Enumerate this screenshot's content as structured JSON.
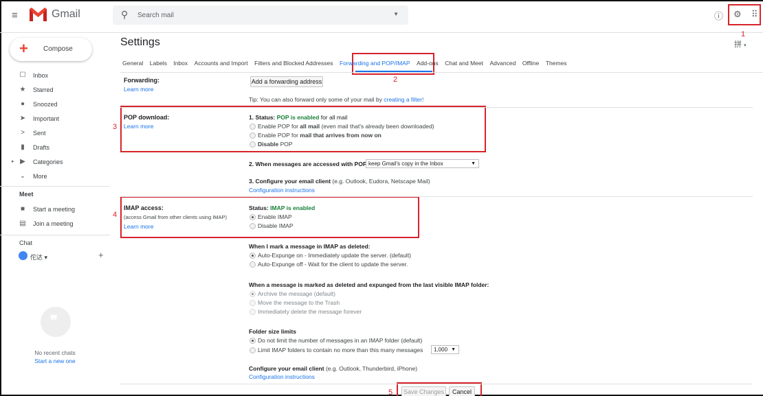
{
  "header": {
    "app_name": "Gmail",
    "search_placeholder": "Search mail"
  },
  "sidebar": {
    "compose_label": "Compose",
    "items": [
      {
        "label": "Inbox",
        "icon": "inbox-icon"
      },
      {
        "label": "Starred",
        "icon": "star-icon"
      },
      {
        "label": "Snoozed",
        "icon": "clock-icon"
      },
      {
        "label": "Important",
        "icon": "important-icon"
      },
      {
        "label": "Sent",
        "icon": "send-icon"
      },
      {
        "label": "Drafts",
        "icon": "draft-icon"
      },
      {
        "label": "Categories",
        "icon": "label-icon"
      },
      {
        "label": "More",
        "icon": "chevron-down-icon"
      }
    ],
    "meet_heading": "Meet",
    "meet_items": [
      {
        "label": "Start a meeting",
        "icon": "video-icon"
      },
      {
        "label": "Join a meeting",
        "icon": "keyboard-icon"
      }
    ],
    "chat_heading": "Chat",
    "chat_user": "佗达 ▾",
    "no_recent": "No recent chats",
    "start_new": "Start a new one"
  },
  "settings": {
    "title": "Settings",
    "ime_glyph": "拼",
    "tabs": [
      "General",
      "Labels",
      "Inbox",
      "Accounts and Import",
      "Filters and Blocked Addresses",
      "Forwarding and POP/IMAP",
      "Add-ons",
      "Chat and Meet",
      "Advanced",
      "Offline",
      "Themes"
    ],
    "active_tab": "Forwarding and POP/IMAP",
    "learn_more": "Learn more",
    "forwarding": {
      "label": "Forwarding:",
      "button": "Add a forwarding address",
      "tip_prefix": "Tip: You can also forward only some of your mail by ",
      "tip_link": "creating a filter!"
    },
    "pop": {
      "label": "POP download:",
      "status_prefix": "1. Status: ",
      "status_value": "POP is enabled",
      "status_suffix": " for all mail",
      "opt1_prefix": "Enable POP for ",
      "opt1_bold": "all mail",
      "opt1_suffix": " (even mail that's already been downloaded)",
      "opt2_prefix": "Enable POP for ",
      "opt2_bold": "mail that arrives from now on",
      "opt3": "Disable",
      "opt3_suffix": " POP",
      "q2": "2. When messages are accessed with POP",
      "q2_select": "keep Gmail's copy in the Inbox",
      "q3": "3. Configure your email client",
      "q3_suffix": " (e.g. Outlook, Eudora, Netscape Mail)",
      "config_link": "Configuration instructions"
    },
    "imap": {
      "label": "IMAP access:",
      "sublabel": "(access Gmail from other clients using IMAP)",
      "status_prefix": "Status: ",
      "status_value": "IMAP is enabled",
      "opt_enable": "Enable IMAP",
      "opt_disable": "Disable IMAP",
      "deleted_heading": "When I mark a message in IMAP as deleted:",
      "deleted_opt1": "Auto-Expunge on - Immediately update the server. (default)",
      "deleted_opt2": "Auto-Expunge off - Wait for the client to update the server.",
      "expunged_heading": "When a message is marked as deleted and expunged from the last visible IMAP folder:",
      "expunged_opt1": "Archive the message (default)",
      "expunged_opt2": "Move the message to the Trash",
      "expunged_opt3": "Immediately delete the message forever",
      "folder_heading": "Folder size limits",
      "folder_opt1": "Do not limit the number of messages in an IMAP folder (default)",
      "folder_opt2": "Limit IMAP folders to contain no more than this many messages",
      "folder_select": "1,000",
      "client_heading": "Configure your email client",
      "client_suffix": " (e.g. Outlook, Thunderbird, iPhone)",
      "config_link": "Configuration instructions"
    },
    "save_label": "Save Changes",
    "cancel_label": "Cancel"
  },
  "annotations": [
    "1",
    "2",
    "3",
    "4",
    "5"
  ],
  "colors": {
    "annotation": "#d6222a",
    "link": "#1a73e8",
    "status_green": "#188038"
  }
}
